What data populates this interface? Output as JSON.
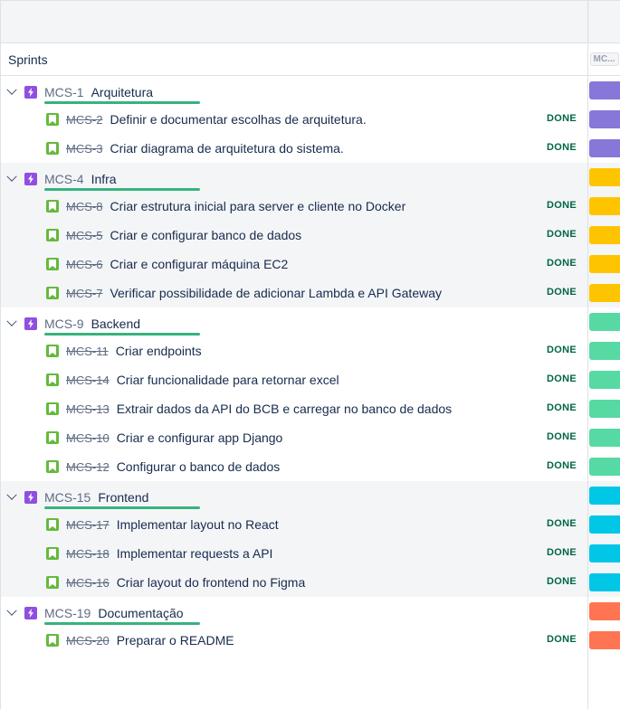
{
  "sprints_label": "Sprints",
  "timeline_badge": "MC...",
  "done_label": "DONE",
  "colors": {
    "purple": "#8777d9",
    "yellow": "#ffc400",
    "green": "#57d9a3",
    "cyan": "#00c7e6",
    "orange": "#ff7452",
    "epic_icon": "#904ee2",
    "story_icon": "#63ba3c",
    "progress": "#36b37e"
  },
  "epics": [
    {
      "key": "MCS-1",
      "title": "Arquitetura",
      "color": "#8777d9",
      "stories": [
        {
          "key": "MCS-2",
          "title": "Definir e documentar escolhas de arquitetura.",
          "status": "DONE"
        },
        {
          "key": "MCS-3",
          "title": "Criar diagrama de arquitetura do sistema.",
          "status": "DONE"
        }
      ]
    },
    {
      "key": "MCS-4",
      "title": "Infra",
      "color": "#ffc400",
      "stories": [
        {
          "key": "MCS-8",
          "title": "Criar estrutura inicial para server e cliente no Docker",
          "status": "DONE"
        },
        {
          "key": "MCS-5",
          "title": "Criar e configurar banco de dados",
          "status": "DONE"
        },
        {
          "key": "MCS-6",
          "title": "Criar e configurar máquina EC2",
          "status": "DONE"
        },
        {
          "key": "MCS-7",
          "title": "Verificar possibilidade de adicionar Lambda e API Gateway",
          "status": "DONE"
        }
      ]
    },
    {
      "key": "MCS-9",
      "title": "Backend",
      "color": "#57d9a3",
      "stories": [
        {
          "key": "MCS-11",
          "title": "Criar endpoints",
          "status": "DONE"
        },
        {
          "key": "MCS-14",
          "title": "Criar funcionalidade para retornar excel",
          "status": "DONE"
        },
        {
          "key": "MCS-13",
          "title": "Extrair dados da API do BCB e carregar no banco de dados",
          "status": "DONE"
        },
        {
          "key": "MCS-10",
          "title": "Criar e configurar app Django",
          "status": "DONE"
        },
        {
          "key": "MCS-12",
          "title": "Configurar o banco de dados",
          "status": "DONE"
        }
      ]
    },
    {
      "key": "MCS-15",
      "title": "Frontend",
      "color": "#00c7e6",
      "stories": [
        {
          "key": "MCS-17",
          "title": "Implementar layout no React",
          "status": "DONE"
        },
        {
          "key": "MCS-18",
          "title": "Implementar requests a API",
          "status": "DONE"
        },
        {
          "key": "MCS-16",
          "title": "Criar layout do frontend no Figma",
          "status": "DONE"
        }
      ]
    },
    {
      "key": "MCS-19",
      "title": "Documentação",
      "color": "#ff7452",
      "stories": [
        {
          "key": "MCS-20",
          "title": "Preparar o README",
          "status": "DONE"
        }
      ]
    }
  ]
}
